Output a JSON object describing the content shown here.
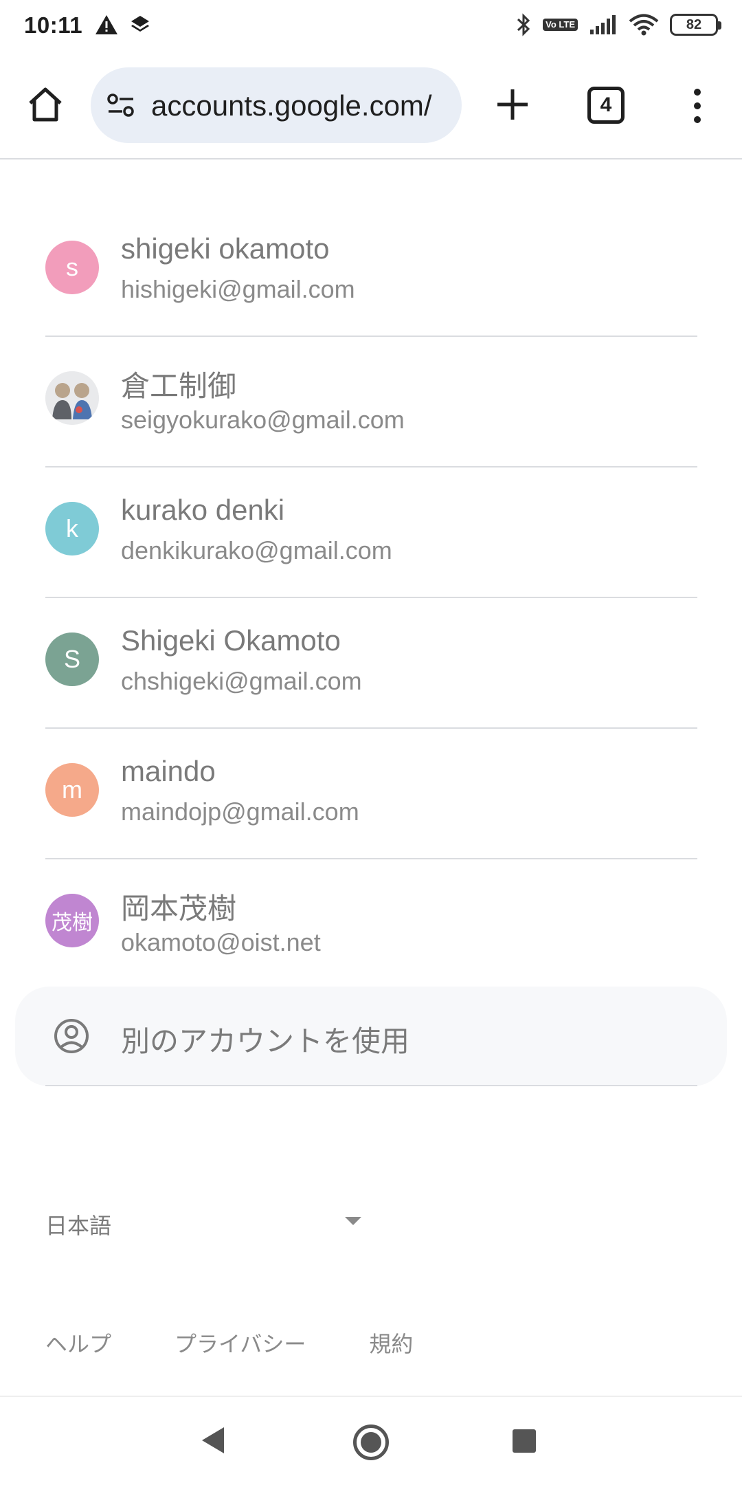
{
  "status_bar": {
    "time": "10:11",
    "battery": "82",
    "volte": "Vo LTE",
    "icons": [
      "alert-icon",
      "layers-icon",
      "bluetooth-icon",
      "volte-icon",
      "signal-icon",
      "wifi-icon",
      "battery-icon"
    ]
  },
  "toolbar": {
    "url": "accounts.google.com/",
    "tab_count": "4",
    "icons": [
      "home-icon",
      "site-settings-icon",
      "new-tab-plus-icon",
      "more-menu-icon"
    ]
  },
  "accounts": [
    {
      "name": "shigeki okamoto",
      "email": "hishigeki@gmail.com",
      "initial": "s",
      "color": "#f29dbb"
    },
    {
      "name": "倉工制御",
      "email": "seigyokurako@gmail.com",
      "initial": "",
      "color": "#e9eaec"
    },
    {
      "name": "kurako denki",
      "email": "denkikurako@gmail.com",
      "initial": "k",
      "color": "#7fcbd6"
    },
    {
      "name": "Shigeki Okamoto",
      "email": "chshigeki@gmail.com",
      "initial": "S",
      "color": "#7ba393"
    },
    {
      "name": "maindo",
      "email": "maindojp@gmail.com",
      "initial": "m",
      "color": "#f5a98a"
    },
    {
      "name": "岡本茂樹",
      "email": "okamoto@oist.net",
      "initial": "茂樹",
      "color": "#c086d1"
    }
  ],
  "other_account": {
    "label": "別のアカウントを使用"
  },
  "language": {
    "selected": "日本語"
  },
  "footer": {
    "help": "ヘルプ",
    "privacy": "プライバシー",
    "terms": "規約"
  }
}
